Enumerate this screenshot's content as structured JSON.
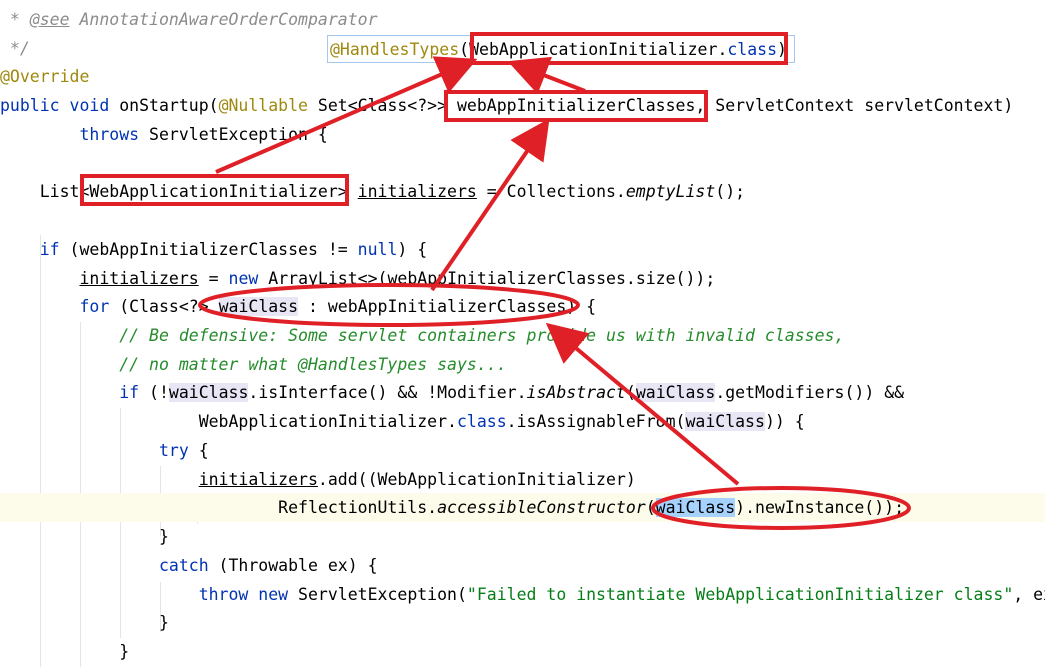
{
  "tooltip": {
    "annotation": "@HandlesTypes",
    "open": "(",
    "type": "WebApplicationInitializer",
    "dot": ".",
    "class_kw": "class",
    "close": ")"
  },
  "code": {
    "l01_star": " * ",
    "l01_tag": "@see",
    "l01_text": " AnnotationAwareOrderComparator",
    "l02": " */",
    "l03": "@Override",
    "l04_public": "public",
    "l04_void": " void ",
    "l04_name": "onStartup(",
    "l04_nullable": "@Nullable",
    "l04_rest": " Set<Class<?>> webAppInitializerClasses, ServletContext servletContext)",
    "l05_throws": "throws",
    "l05_rest": " ServletException {",
    "l07_a": "List<WebApplicationInitializer> ",
    "l07_field": "initializers",
    "l07_b": " = Collections.",
    "l07_call": "emptyList",
    "l07_c": "();",
    "l09_if": "if",
    "l09_a": " (webAppInitializerClasses != ",
    "l09_null": "null",
    "l09_b": ") {",
    "l10_field": "initializers",
    "l10_a": " = ",
    "l10_new": "new",
    "l10_b": " ArrayList<>(webAppInitializerClasses.size());",
    "l11_for": "for",
    "l11_a": " (Class<?> ",
    "l11_var": "waiClass",
    "l11_b": " : webAppInitializerClasses) {",
    "l12": "// Be defensive: Some servlet containers provide us with invalid classes,",
    "l13": "// no matter what @HandlesTypes says...",
    "l14_if": "if",
    "l14_a": " (!",
    "l14_var1": "waiClass",
    "l14_b": ".isInterface() && !Modifier.",
    "l14_call": "isAbstract",
    "l14_c": "(",
    "l14_var2": "waiClass",
    "l14_d": ".getModifiers()) &&",
    "l15_a": "WebApplicationInitializer.",
    "l15_class": "class",
    "l15_b": ".isAssignableFrom(",
    "l15_var": "waiClass",
    "l15_c": ")) {",
    "l16_try": "try",
    "l16_a": " {",
    "l17_field": "initializers",
    "l17_a": ".add((WebApplicationInitializer)",
    "l18_a": "ReflectionUtils.",
    "l18_call": "accessibleConstructor",
    "l18_b": "(",
    "l18_var": "waiClass",
    "l18_c": ").newInstance());",
    "l19": "}",
    "l20_catch": "catch",
    "l20_a": " (Throwable ex) {",
    "l21_throw": "throw",
    "l21_sp": " ",
    "l21_new": "new",
    "l21_a": " ServletException(",
    "l21_str": "\"Failed to instantiate WebApplicationInitializer class\"",
    "l21_b": ", ex);",
    "l22": "}",
    "l23": "}"
  },
  "annotation_color": "#e02027"
}
